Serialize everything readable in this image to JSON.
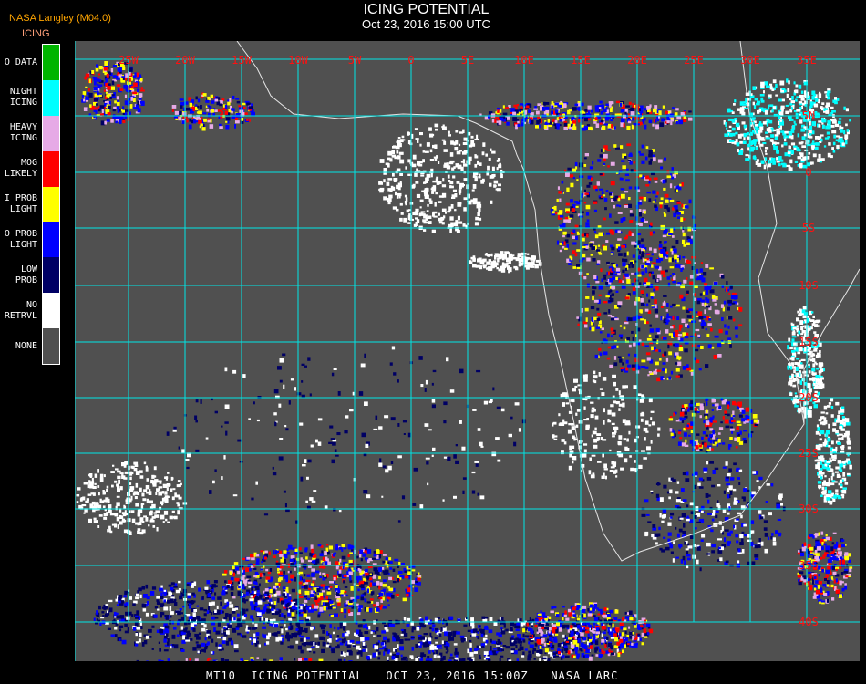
{
  "header": {
    "organization": "NASA Langley (M04.0)",
    "product": "ICING",
    "title": "ICING POTENTIAL",
    "datetime": "Oct 23, 2016 15:00 UTC"
  },
  "legend": [
    {
      "label": "O DATA",
      "color": "#00b400"
    },
    {
      "label": "NIGHT\nICING",
      "color": "#00ffff"
    },
    {
      "label": "HEAVY\nICING",
      "color": "#e6aae6"
    },
    {
      "label": "MOG\nLIKELY",
      "color": "#ff0000"
    },
    {
      "label": "I PROB\nLIGHT",
      "color": "#ffff00"
    },
    {
      "label": "O PROB\nLIGHT",
      "color": "#0000ff"
    },
    {
      "label": "LOW\nPROB",
      "color": "#000064"
    },
    {
      "label": "NO\nRETRVL",
      "color": "#ffffff"
    },
    {
      "label": "NONE",
      "color": "#505050"
    }
  ],
  "map": {
    "background": "#505050",
    "grid_color": "#00e6e6",
    "label_color": "#ff1010",
    "longitudes": [
      "25W",
      "20W",
      "15W",
      "10W",
      "5W",
      "0",
      "5E",
      "10E",
      "15E",
      "20E",
      "25E",
      "30E",
      "35E"
    ],
    "latitudes": [
      "5N",
      "0",
      "5S",
      "10S",
      "15S",
      "20S",
      "25S",
      "30S",
      "35S",
      "40S"
    ]
  },
  "footer": "MT10  ICING POTENTIAL   OCT 23, 2016 15:00Z   NASA LARC"
}
